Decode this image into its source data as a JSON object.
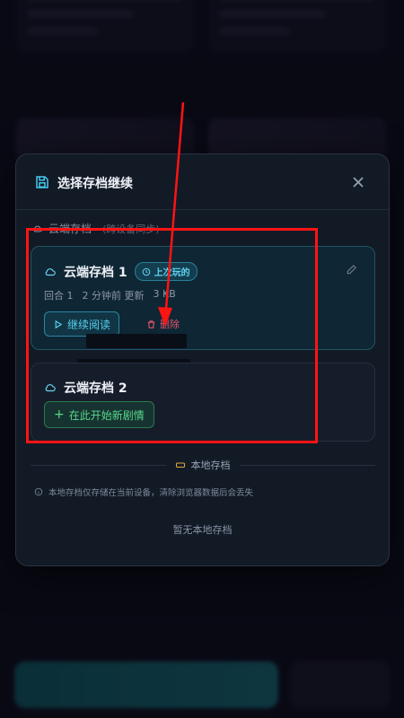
{
  "modal": {
    "title": "选择存档继续",
    "close_icon": "close-icon",
    "save_icon": "save-icon"
  },
  "cloud_section": {
    "label": "云端存档",
    "hint": "(跨设备同步)"
  },
  "saves": [
    {
      "name": "云端存档 1",
      "badge": "上次玩的",
      "round": "回合 1",
      "updated": "2 分钟前 更新",
      "size": "3 KB",
      "continue_label": "继续阅读",
      "delete_label": "删除"
    },
    {
      "name": "云端存档 2",
      "start_label": "在此开始新剧情"
    }
  ],
  "local_section": {
    "label": "本地存档",
    "note": "本地存档仅存储在当前设备，清除浏览器数据后会丢失",
    "empty_text": "暂无本地存档"
  },
  "colors": {
    "accent_cyan": "#58d2f0",
    "accent_green": "#55d98a",
    "danger_red": "#e0566b",
    "annotation_red": "#ff1414"
  }
}
